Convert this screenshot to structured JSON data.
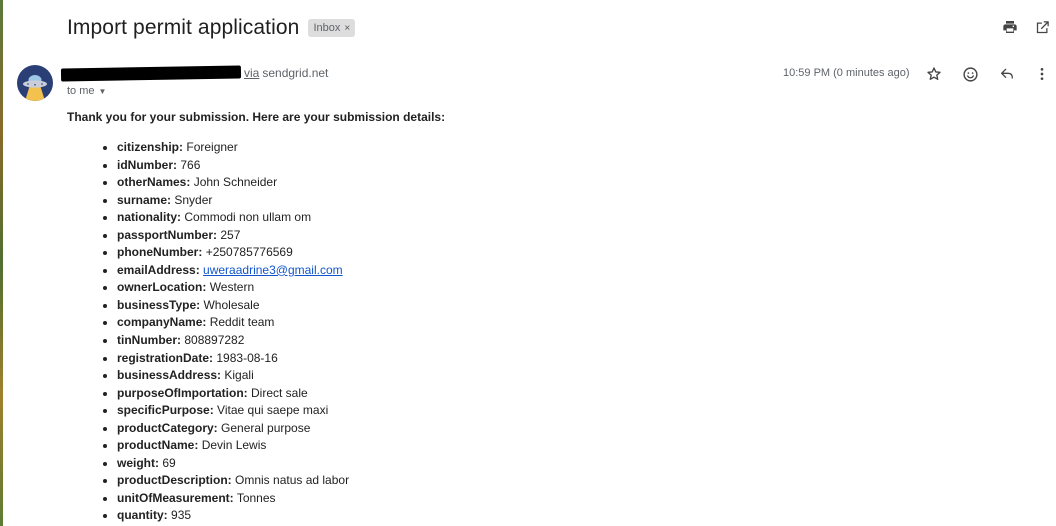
{
  "email": {
    "subject": "Import permit application",
    "label": "Inbox",
    "label_close": "×",
    "sender_via": "via",
    "sender_domain": "sendgrid.net",
    "recipient": "to me",
    "time": "10:59 PM (0 minutes ago)",
    "intro": "Thank you for your submission. Here are your submission details:"
  },
  "fields": [
    {
      "key": "citizenship:",
      "value": "Foreigner"
    },
    {
      "key": "idNumber:",
      "value": "766"
    },
    {
      "key": "otherNames:",
      "value": "John Schneider"
    },
    {
      "key": "surname:",
      "value": "Snyder"
    },
    {
      "key": "nationality:",
      "value": "Commodi non ullam om"
    },
    {
      "key": "passportNumber:",
      "value": "257"
    },
    {
      "key": "phoneNumber:",
      "value": "+250785776569"
    },
    {
      "key": "emailAddress:",
      "value": "uweraadrine3@gmail.com"
    },
    {
      "key": "ownerLocation:",
      "value": "Western"
    },
    {
      "key": "businessType:",
      "value": "Wholesale"
    },
    {
      "key": "companyName:",
      "value": "Reddit team"
    },
    {
      "key": "tinNumber:",
      "value": "808897282"
    },
    {
      "key": "registrationDate:",
      "value": "1983-08-16"
    },
    {
      "key": "businessAddress:",
      "value": "Kigali"
    },
    {
      "key": "purposeOfImportation:",
      "value": "Direct sale"
    },
    {
      "key": "specificPurpose:",
      "value": "Vitae qui saepe maxi"
    },
    {
      "key": "productCategory:",
      "value": "General purpose"
    },
    {
      "key": "productName:",
      "value": "Devin Lewis"
    },
    {
      "key": "weight:",
      "value": "69"
    },
    {
      "key": "productDescription:",
      "value": "Omnis natus ad labor"
    },
    {
      "key": "unitOfMeasurement:",
      "value": "Tonnes"
    },
    {
      "key": "quantity:",
      "value": "935"
    }
  ],
  "icons": {
    "print": "print-icon",
    "popout": "open-in-new-window-icon",
    "star": "star-icon",
    "emoji": "emoji-reaction-icon",
    "reply": "reply-icon",
    "more": "more-options-icon",
    "avatar": "ufo-avatar-icon"
  },
  "colors": {
    "link": "#1155cc",
    "label_bg": "#dddddd",
    "avatar_bg": "#2b3f77",
    "muted_text": "#5f6368"
  }
}
